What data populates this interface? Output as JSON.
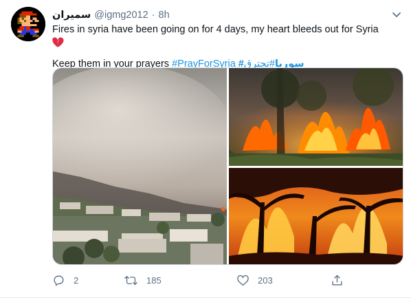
{
  "tweet": {
    "author_name": "سميران",
    "handle": "@igmg2012",
    "separator": "·",
    "time": "8h",
    "text_line1": "Fires in syria have been going on for 4 days, my heart bleeds out for Syria",
    "text_line2_prefix": "Keep them in your prayers",
    "hashtags": [
      "#PrayForSyria",
      "#سوريا",
      "#تحترق_"
    ]
  },
  "actions": {
    "reply_count": "2",
    "retweet_count": "185",
    "like_count": "203"
  },
  "colors": {
    "link": "#1b95e0",
    "secondary_text": "#5b7083",
    "broken_heart": "#dd2e44"
  }
}
